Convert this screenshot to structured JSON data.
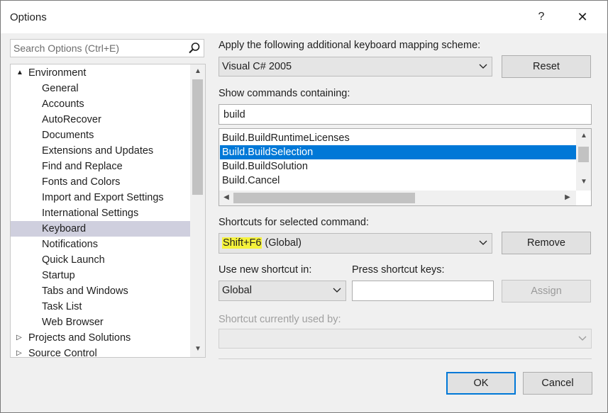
{
  "window": {
    "title": "Options",
    "help_label": "?",
    "close_label": "✕"
  },
  "search": {
    "placeholder": "Search Options (Ctrl+E)"
  },
  "tree": {
    "items": [
      {
        "label": "Environment",
        "level": 0,
        "expander": "▲"
      },
      {
        "label": "General",
        "level": 1
      },
      {
        "label": "Accounts",
        "level": 1
      },
      {
        "label": "AutoRecover",
        "level": 1
      },
      {
        "label": "Documents",
        "level": 1
      },
      {
        "label": "Extensions and Updates",
        "level": 1
      },
      {
        "label": "Find and Replace",
        "level": 1
      },
      {
        "label": "Fonts and Colors",
        "level": 1
      },
      {
        "label": "Import and Export Settings",
        "level": 1
      },
      {
        "label": "International Settings",
        "level": 1
      },
      {
        "label": "Keyboard",
        "level": 1,
        "selected": true
      },
      {
        "label": "Notifications",
        "level": 1
      },
      {
        "label": "Quick Launch",
        "level": 1
      },
      {
        "label": "Startup",
        "level": 1
      },
      {
        "label": "Tabs and Windows",
        "level": 1
      },
      {
        "label": "Task List",
        "level": 1
      },
      {
        "label": "Web Browser",
        "level": 1
      },
      {
        "label": "Projects and Solutions",
        "level": 0,
        "expander": "▷"
      },
      {
        "label": "Source Control",
        "level": 0,
        "expander": "▷"
      }
    ]
  },
  "mapping": {
    "label": "Apply the following additional keyboard mapping scheme:",
    "selected": "Visual C# 2005",
    "reset_label": "Reset"
  },
  "commands": {
    "label": "Show commands containing:",
    "filter_value": "build",
    "items": [
      {
        "label": "Build.BuildRuntimeLicenses"
      },
      {
        "label": "Build.BuildSelection",
        "selected": true
      },
      {
        "label": "Build.BuildSolution"
      },
      {
        "label": "Build.Cancel"
      }
    ]
  },
  "shortcuts": {
    "label": "Shortcuts for selected command:",
    "key": "Shift+F6",
    "scope": " (Global)",
    "highlight_color": "#f5f23b",
    "remove_label": "Remove"
  },
  "new_shortcut": {
    "use_in_label": "Use new shortcut in:",
    "use_in_selected": "Global",
    "press_keys_label": "Press shortcut keys:",
    "press_keys_value": "",
    "assign_label": "Assign"
  },
  "used_by": {
    "label": "Shortcut currently used by:",
    "selected": ""
  },
  "footer": {
    "ok_label": "OK",
    "cancel_label": "Cancel"
  },
  "colors": {
    "selection_blue": "#0078d7",
    "tree_selection": "#cfcfde",
    "dialog_bg": "#f0f0f0"
  }
}
